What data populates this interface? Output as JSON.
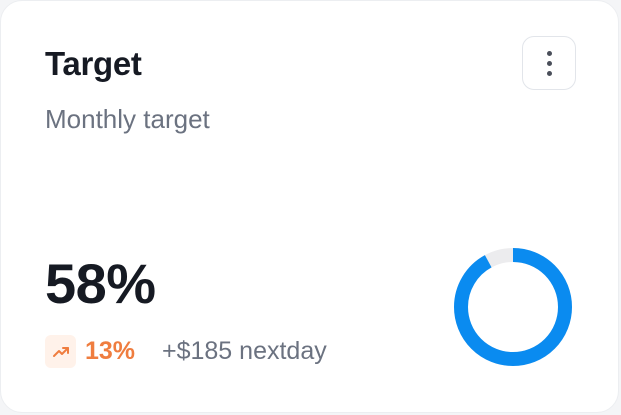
{
  "card": {
    "title": "Target",
    "subtitle": "Monthly target",
    "menu_icon": "more-vertical-icon"
  },
  "metric": {
    "value": "58%",
    "progress_fraction": 0.92,
    "trend_icon": "trending-up-icon",
    "trend_percent": "13%",
    "trend_note": "+$185 nextday"
  },
  "colors": {
    "ring_progress": "#0a8bf0",
    "ring_track": "#ececee",
    "trend_accent": "#ef7d3f",
    "title_text": "#161a23",
    "muted_text": "#6b7280"
  }
}
